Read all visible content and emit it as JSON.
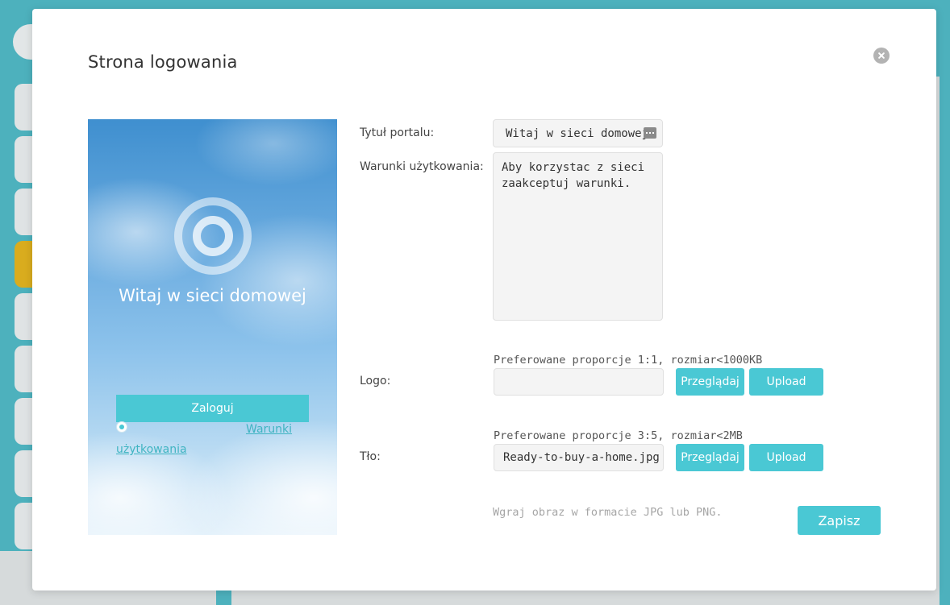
{
  "modal": {
    "title": "Strona logowania"
  },
  "preview": {
    "portal_title": "Witaj w sieci domowej",
    "login_button": "Zaloguj",
    "terms_link_part1": "Warunki",
    "terms_link_part2": "użytkowania"
  },
  "form": {
    "portal_title_label": "Tytuł portalu:",
    "portal_title_value": "Witaj w sieci domowej",
    "terms_label": "Warunki użytkowania:",
    "terms_value": "Aby korzystac z sieci\nzaakceptuj warunki.",
    "logo": {
      "hint": "Preferowane proporcje 1:1, rozmiar<1000KB",
      "label": "Logo:",
      "file_name": "",
      "browse_button": "Przeglądaj",
      "upload_button": "Upload"
    },
    "background": {
      "hint": "Preferowane proporcje 3:5, rozmiar<2MB",
      "label": "Tło:",
      "file_name": "Ready-to-buy-a-home.jpg",
      "browse_button": "Przeglądaj",
      "upload_button": "Upload"
    },
    "format_note": "Wgraj obraz w formacie JPG lub PNG.",
    "save_button": "Zapisz"
  },
  "colors": {
    "accent": "#4ac8d4",
    "page_background": "#4db1bd",
    "active_tab": "#d9ac1e"
  },
  "icons": {
    "close": "close-icon",
    "title_field": "text-options-icon",
    "preview_logo": "portal-logo-icon"
  }
}
